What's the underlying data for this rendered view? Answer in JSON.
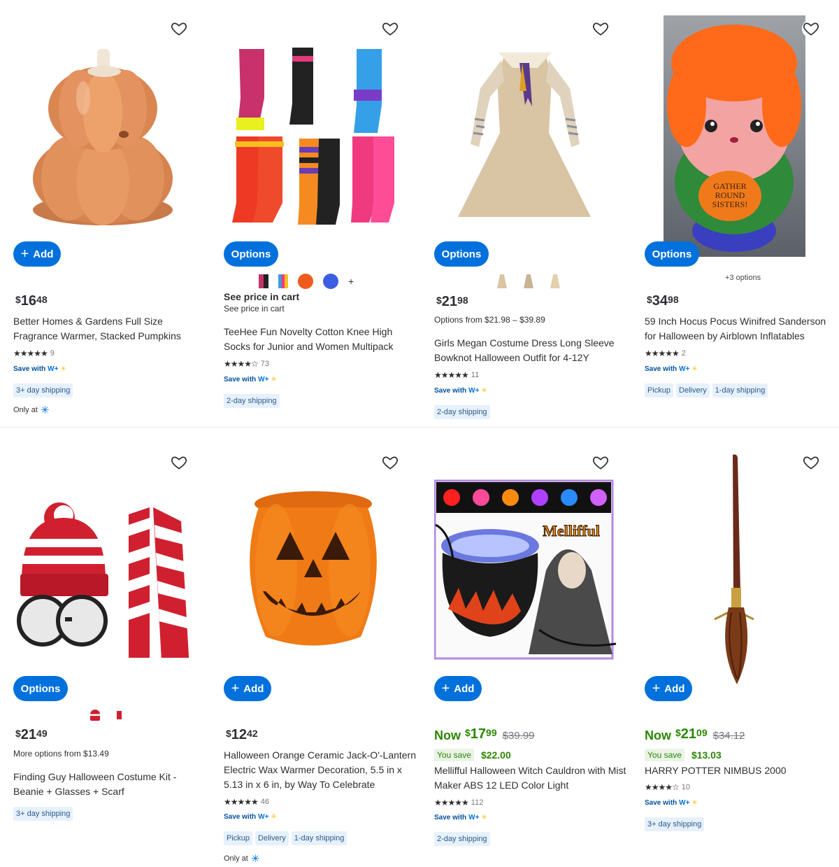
{
  "colors": {
    "primary_blue": "#0071dc",
    "now_green": "#2a8703",
    "badge_bg": "#e6f1fc"
  },
  "products": [
    {
      "button": "Add",
      "button_icon": "plus-icon",
      "price": {
        "dollars": "16",
        "cents": "48"
      },
      "title": "Better Homes & Gardens Full Size Fragrance Warmer, Stacked Pumpkins",
      "rating": {
        "stars": 4.5,
        "count": "9"
      },
      "save_with": "Save with",
      "wplus": "W+",
      "badges": [
        "3+ day shipping"
      ],
      "only_at": "Only at"
    },
    {
      "button": "Options",
      "swatch_more": "+",
      "see_price_main": "See price in cart",
      "see_price_sub": "See price in cart",
      "title": "TeeHee Fun Novelty Cotton Knee High Socks for Junior and Women Multipack",
      "rating": {
        "stars": 4,
        "count": "73"
      },
      "save_with": "Save with",
      "wplus": "W+",
      "badges": [
        "2-day shipping"
      ]
    },
    {
      "button": "Options",
      "price": {
        "dollars": "21",
        "cents": "98"
      },
      "options_from": "Options from $21.98 – $39.89",
      "title": "Girls Megan Costume Dress Long Sleeve Bowknot Halloween Outfit for 4-12Y",
      "rating": {
        "stars": 4.5,
        "count": "11"
      },
      "save_with": "Save with",
      "wplus": "W+",
      "badges": [
        "2-day shipping"
      ]
    },
    {
      "button": "Options",
      "more_options": "+3 options",
      "price": {
        "dollars": "34",
        "cents": "98"
      },
      "title": "59 Inch Hocus Pocus Winifred Sanderson for Halloween by Airblown Inflatables",
      "rating": {
        "stars": 5,
        "count": "2"
      },
      "save_with": "Save with",
      "wplus": "W+",
      "badges": [
        "Pickup",
        "Delivery",
        "1-day shipping"
      ],
      "image_text": "GATHER ROUND SISTERS!"
    },
    {
      "button": "Options",
      "price": {
        "dollars": "21",
        "cents": "49"
      },
      "more_options_from": "More options from $13.49",
      "title": "Finding Guy Halloween Costume Kit - Beanie + Glasses + Scarf",
      "badges": [
        "3+ day shipping"
      ]
    },
    {
      "button": "Add",
      "price": {
        "dollars": "12",
        "cents": "42"
      },
      "title": "Halloween Orange Ceramic Jack-O'-Lantern Electric Wax Warmer Decoration, 5.5 in x 5.13 in x 6 in, by Way To Celebrate",
      "rating": {
        "stars": 4.5,
        "count": "46"
      },
      "save_with": "Save with",
      "wplus": "W+",
      "badges": [
        "Pickup",
        "Delivery",
        "1-day shipping"
      ],
      "only_at": "Only at"
    },
    {
      "button": "Add",
      "now_label": "Now",
      "price": {
        "dollars": "17",
        "cents": "99"
      },
      "was": "$39.99",
      "you_save_label": "You save",
      "you_save": "$22.00",
      "title": "Mellifful Halloween Witch Cauldron with Mist Maker ABS 12 LED Color Light",
      "rating": {
        "stars": 4.5,
        "count": "112"
      },
      "save_with": "Save with",
      "wplus": "W+",
      "badges": [
        "2-day shipping"
      ],
      "image_text": "Mellifful"
    },
    {
      "button": "Add",
      "now_label": "Now",
      "price": {
        "dollars": "21",
        "cents": "09"
      },
      "was": "$34.12",
      "you_save_label": "You save",
      "you_save": "$13.03",
      "title": "HARRY POTTER NIMBUS 2000",
      "rating": {
        "stars": 3.5,
        "count": "10"
      },
      "save_with": "Save with",
      "wplus": "W+",
      "badges": [
        "3+ day shipping"
      ]
    }
  ]
}
